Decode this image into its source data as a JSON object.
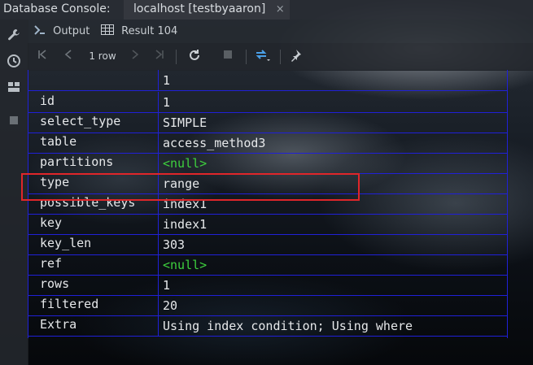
{
  "window": {
    "app_title": "Database Console:",
    "tab_title": "localhost [testbyaaron]",
    "tab_close": "×"
  },
  "tabs": {
    "output_label": "Output",
    "result_label": "Result 104"
  },
  "toolbar": {
    "rows_label": "1 row"
  },
  "header_row": {
    "value": "1"
  },
  "rows": [
    {
      "key": "id",
      "value": "1"
    },
    {
      "key": "select_type",
      "value": "SIMPLE"
    },
    {
      "key": "table",
      "value": "access_method3"
    },
    {
      "key": "partitions",
      "value": "<null>"
    },
    {
      "key": "type",
      "value": "range"
    },
    {
      "key": "possible_keys",
      "value": "index1"
    },
    {
      "key": "key",
      "value": "index1"
    },
    {
      "key": "key_len",
      "value": "303"
    },
    {
      "key": "ref",
      "value": "<null>"
    },
    {
      "key": "rows",
      "value": "1"
    },
    {
      "key": "filtered",
      "value": "20"
    },
    {
      "key": "Extra",
      "value": "Using index condition; Using where"
    }
  ],
  "colors": {
    "grid_line": "#2020d8",
    "null_text": "#3ed13e",
    "highlight": "#e0262a"
  },
  "icons": [
    "wrench-icon",
    "clock-icon",
    "layout-icon",
    "stop-square-icon",
    "output-icon",
    "table-icon",
    "first-page-icon",
    "prev-page-icon",
    "next-page-icon",
    "last-page-icon",
    "refresh-icon",
    "stop-icon",
    "transpose-icon",
    "pin-icon"
  ]
}
